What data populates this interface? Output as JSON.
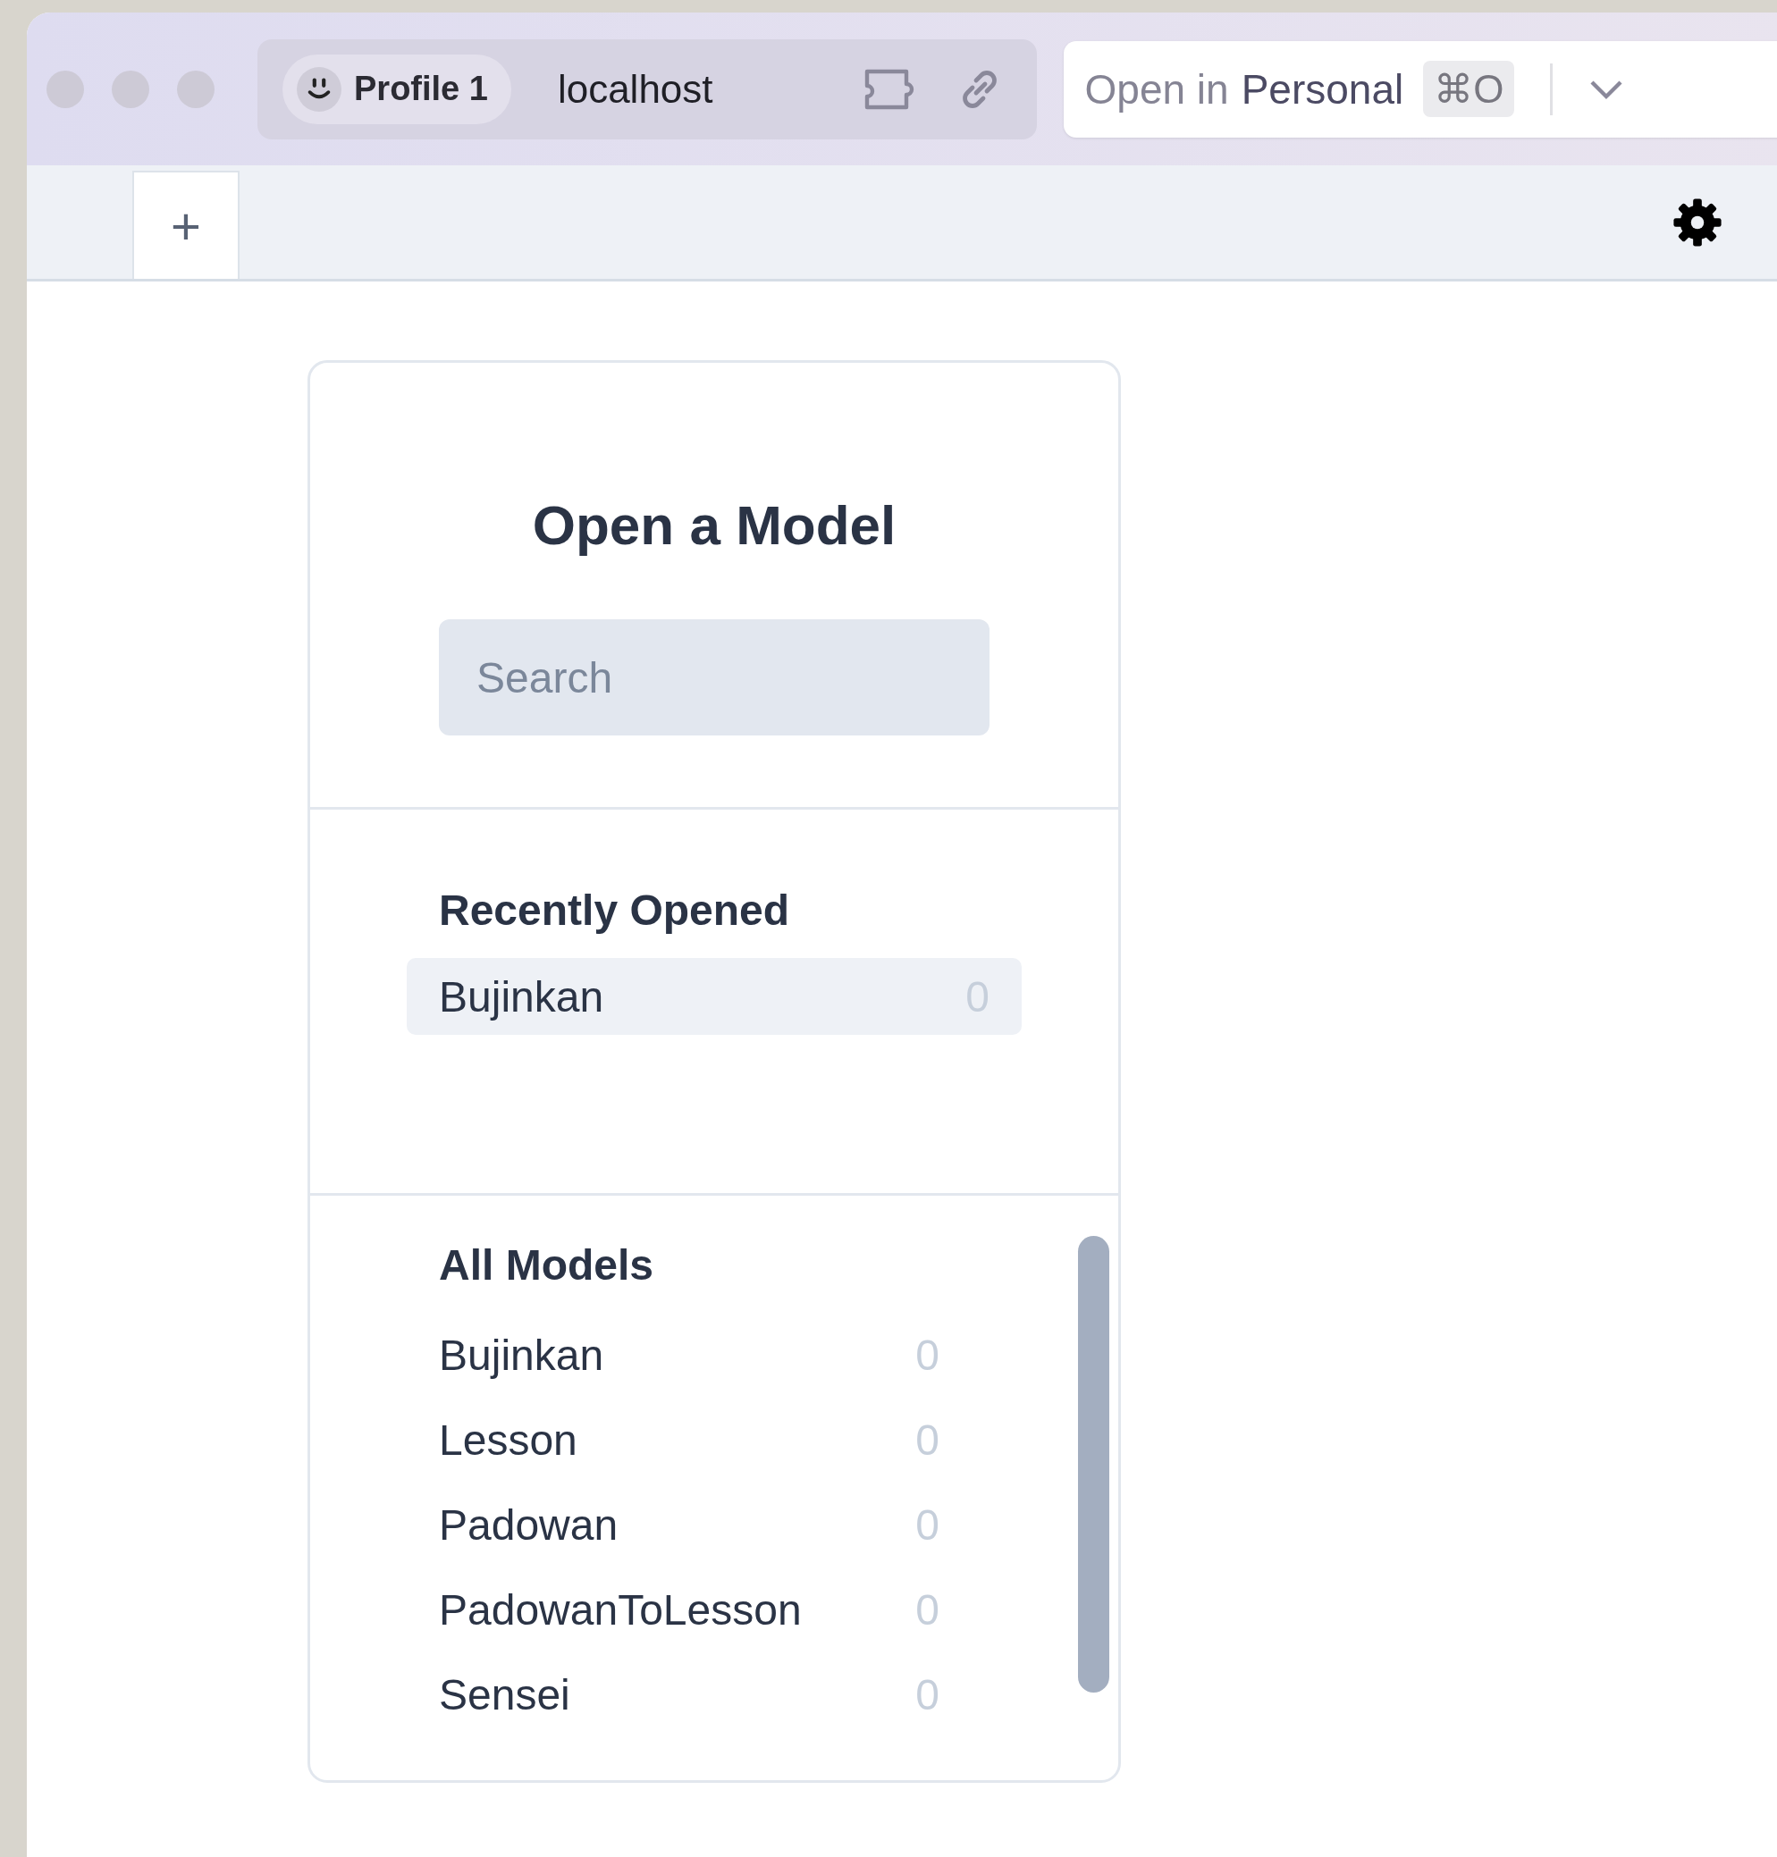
{
  "browser": {
    "profile": "Profile 1",
    "address": "localhost",
    "open_button": {
      "prefix": "Open in",
      "target": "Personal",
      "shortcut": "⌘O"
    }
  },
  "toolbar": {
    "new_tab": "+"
  },
  "panel": {
    "title": "Open a Model",
    "search": {
      "placeholder": "Search"
    },
    "recent": {
      "heading": "Recently Opened",
      "items": [
        {
          "name": "Bujinkan",
          "count": "0",
          "selected": true
        }
      ]
    },
    "all": {
      "heading": "All Models",
      "items": [
        {
          "name": "Bujinkan",
          "count": "0",
          "selected": false
        },
        {
          "name": "Lesson",
          "count": "0",
          "selected": false
        },
        {
          "name": "Padowan",
          "count": "0",
          "selected": false
        },
        {
          "name": "PadowanToLesson",
          "count": "0",
          "selected": false
        },
        {
          "name": "Sensei",
          "count": "0",
          "selected": false
        }
      ]
    }
  }
}
